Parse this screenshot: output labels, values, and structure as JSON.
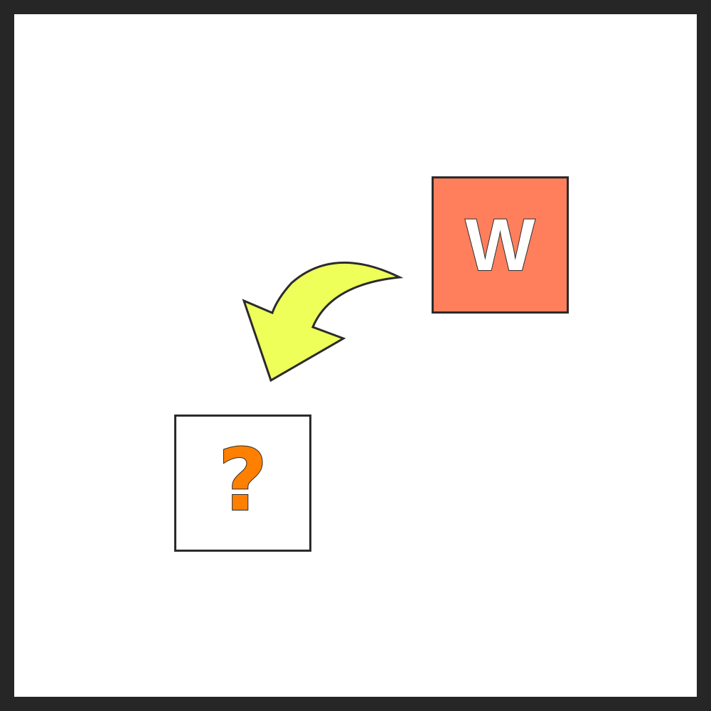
{
  "source_tile": {
    "letter": "W",
    "fill_color": "#FF7F5C",
    "letter_color": "#FFFFFF"
  },
  "target_tile": {
    "symbol": "?",
    "fill_color": "#FFFFFF",
    "symbol_color": "#FF8000"
  },
  "arrow": {
    "icon": "curved-arrow-down-left-icon",
    "fill_color": "#EEFF5A",
    "stroke_color": "#2B2B2B"
  },
  "frame": {
    "border_color": "#262626"
  }
}
